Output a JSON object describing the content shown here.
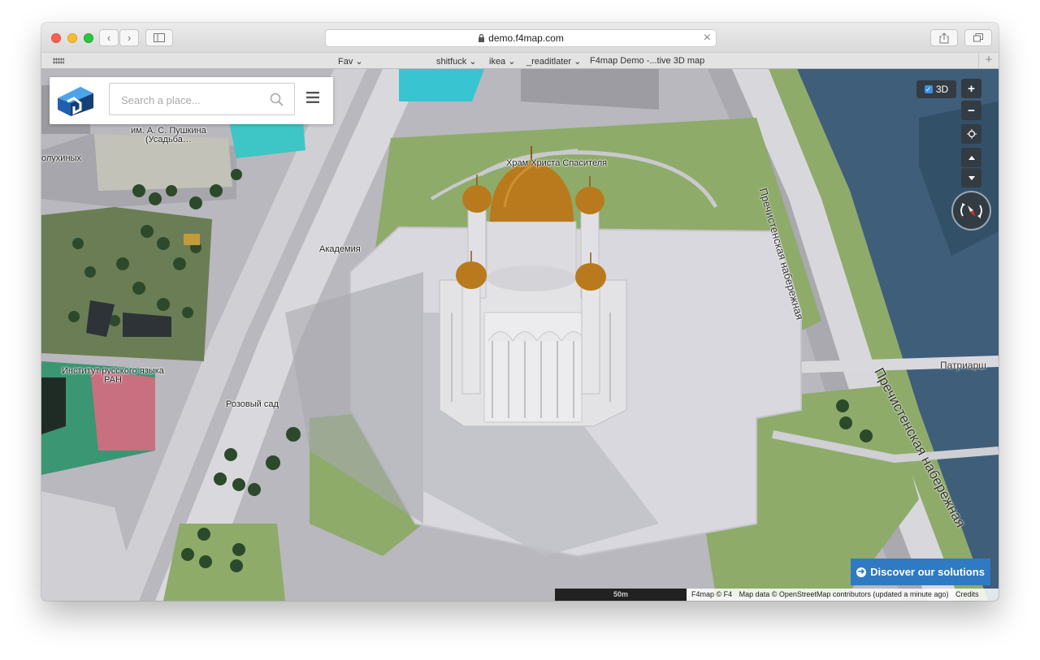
{
  "browser": {
    "url": "demo.f4map.com",
    "favorites": [
      {
        "label": "Fav",
        "chevron": true
      },
      {
        "label": "shitfuck",
        "chevron": true
      },
      {
        "label": "ikea",
        "chevron": true
      },
      {
        "label": "_readitlater",
        "chevron": true
      },
      {
        "label": "F4map Demo -...tive 3D map",
        "chevron": false
      }
    ]
  },
  "search": {
    "placeholder": "Search a place..."
  },
  "map_labels": {
    "cathedral": "Храм Христа Спасителя",
    "pushkin_1": "им. А. С. Пушкина",
    "pushkin_2": "(Усадьба…",
    "volkhonka": "олухиных",
    "academy": "Академия",
    "institute_1": "Институт русского языка",
    "institute_2": "РАН",
    "rose_garden": "Розовый сад",
    "embankment_top": "Пречистенская набережная",
    "embankment_bottom": "Пречистенская набережная",
    "patriarch": "Патриарш"
  },
  "controls": {
    "toggle_3d": "3D",
    "zoom_in": "+",
    "zoom_out": "−"
  },
  "discover_label": "Discover our solutions",
  "scale": "50m",
  "attribution": {
    "f4": "F4map © F4",
    "osm": "Map data © OpenStreetMap contributors (updated a minute ago)",
    "credits": "Credits"
  },
  "colors": {
    "control_bg": "#333c42",
    "discover_bg": "#2f7ac2",
    "water": "#3f5e79",
    "grass": "#8eab6a",
    "dome": "#b97a1d"
  }
}
